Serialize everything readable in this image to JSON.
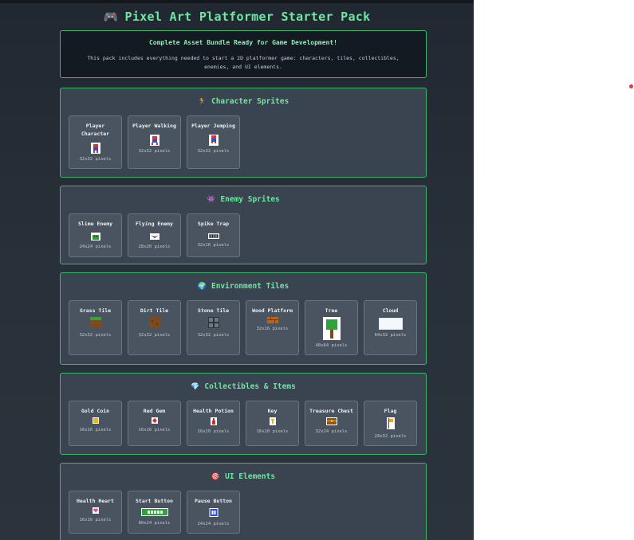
{
  "header": {
    "icon": "gamepad-icon",
    "title": "Pixel Art Platformer Starter Pack"
  },
  "intro": {
    "heading": "Complete Asset Bundle Ready for Game Development!",
    "body": "This pack includes everything needed to start a 2D platformer game: characters, tiles, collectibles, enemies, and UI elements."
  },
  "sections": {
    "characters": {
      "icon": "🏃",
      "title": "Character Sprites",
      "items": [
        {
          "name": "Player Character",
          "size": "32x32 pixels"
        },
        {
          "name": "Player Walking",
          "size": "32x32 pixels"
        },
        {
          "name": "Player Jumping",
          "size": "32x32 pixels"
        }
      ]
    },
    "enemies": {
      "icon": "👾",
      "title": "Enemy Sprites",
      "items": [
        {
          "name": "Slime Enemy",
          "size": "24x24 pixels"
        },
        {
          "name": "Flying Enemy",
          "size": "28x20 pixels"
        },
        {
          "name": "Spike Trap",
          "size": "32x16 pixels"
        }
      ]
    },
    "environment": {
      "icon": "🌍",
      "title": "Environment Tiles",
      "items": [
        {
          "name": "Grass Tile",
          "size": "32x32 pixels"
        },
        {
          "name": "Dirt Tile",
          "size": "32x32 pixels"
        },
        {
          "name": "Stone Tile",
          "size": "32x32 pixels"
        },
        {
          "name": "Wood Platform",
          "size": "32x16 pixels"
        },
        {
          "name": "Tree",
          "size": "48x64 pixels"
        },
        {
          "name": "Cloud",
          "size": "64x32 pixels"
        }
      ]
    },
    "collectibles": {
      "icon": "💎",
      "title": "Collectibles & Items",
      "items": [
        {
          "name": "Gold Coin",
          "size": "16x16 pixels"
        },
        {
          "name": "Red Gem",
          "size": "16x16 pixels"
        },
        {
          "name": "Health Potion",
          "size": "16x20 pixels"
        },
        {
          "name": "Key",
          "size": "16x20 pixels"
        },
        {
          "name": "Treasure Chest",
          "size": "32x24 pixels"
        },
        {
          "name": "Flag",
          "size": "24x32 pixels"
        }
      ]
    },
    "ui": {
      "icon": "🎯",
      "title": "UI Elements",
      "items": [
        {
          "name": "Health Heart",
          "size": "16x16 pixels"
        },
        {
          "name": "Start Button",
          "size": "80x24 pixels"
        },
        {
          "name": "Pause Button",
          "size": "24x24 pixels"
        }
      ]
    }
  },
  "colors": {
    "accent": "#6ee7a0",
    "border": "#3fb56e",
    "panel": "#3a4350",
    "card": "#4a5360"
  }
}
